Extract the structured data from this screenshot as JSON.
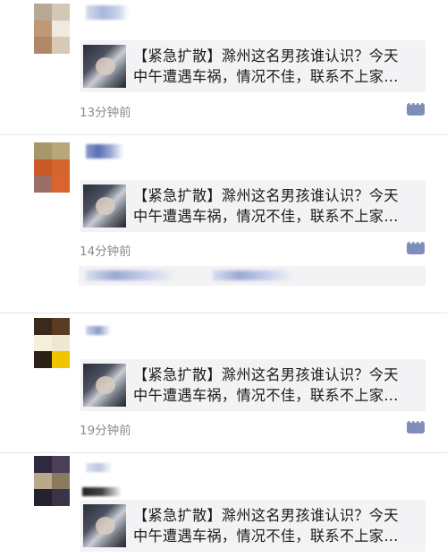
{
  "feed": {
    "posts": [
      {
        "shared_title": "【紧急扩散】滁州这名男孩谁认识？今天",
        "shared_line2": "中午遭遇车祸，情况不佳，联系不上家…",
        "time": "13分钟前",
        "icon": "comment-icon"
      },
      {
        "shared_title": "【紧急扩散】滁州这名男孩谁认识？今天",
        "shared_line2": "中午遭遇车祸，情况不佳，联系不上家…",
        "time": "14分钟前",
        "icon": "comment-icon"
      },
      {
        "shared_title": "【紧急扩散】滁州这名男孩谁认识？今天",
        "shared_line2": "中午遭遇车祸，情况不佳，联系不上家…",
        "time": "19分钟前",
        "icon": "comment-icon"
      },
      {
        "shared_title": "【紧急扩散】滁州这名男孩谁认识？今天",
        "shared_line2": "中午遭遇车祸，情况不佳，联系不上家…"
      }
    ]
  },
  "colors": {
    "link_icon": "#7d8fb8",
    "card_bg": "#f3f3f5",
    "time_text": "#8b8b8b"
  }
}
